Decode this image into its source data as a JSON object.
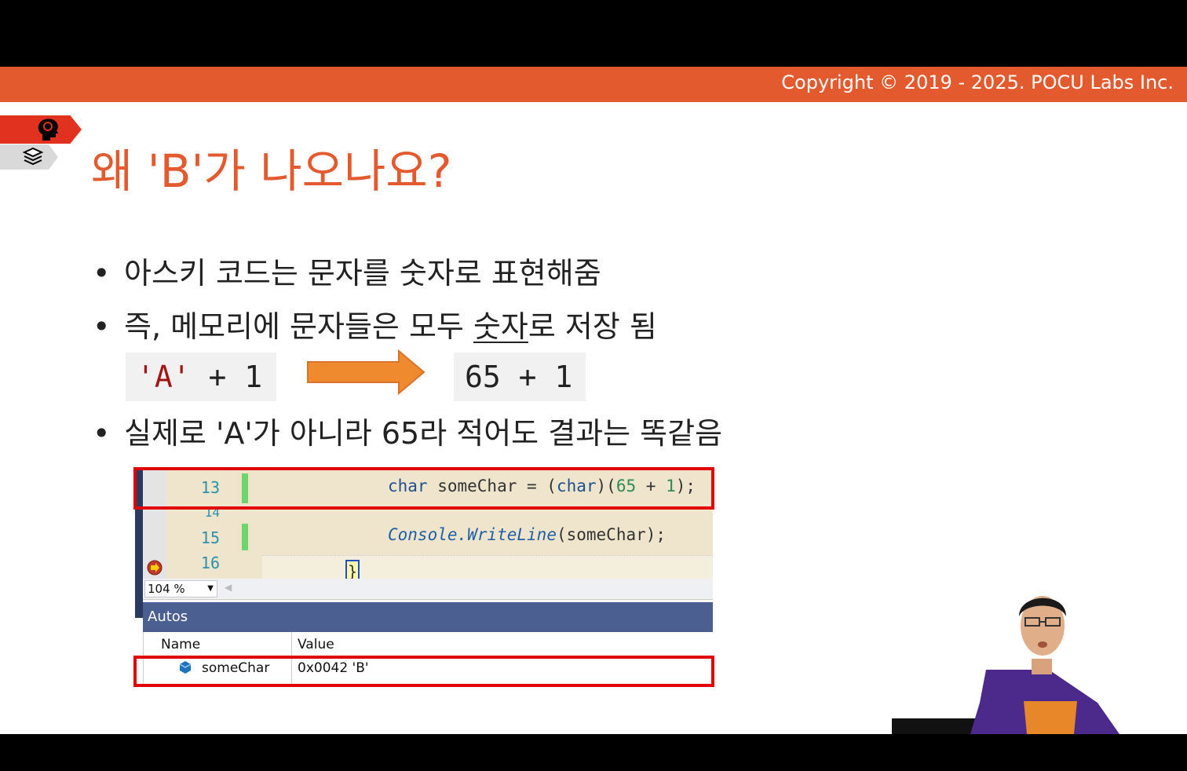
{
  "copyright": "Copyright © 2019 - 2025. POCU Labs Inc.",
  "side_tabs": {
    "top_icon": "brain-head-icon",
    "bottom_icon": "book-stack-icon"
  },
  "title": "왜 'B'가 나오나요?",
  "bullets": [
    {
      "symbol": "•",
      "text": "아스키 코드는 문자를 숫자로 표현해줌"
    },
    {
      "symbol": "•",
      "before": "즉, 메모리에 문자들은 모두 ",
      "emphasis": "숫자",
      "after": "로 저장 됨"
    },
    {
      "symbol": "•",
      "text": "실제로 'A'가 아니라 65라 적어도 결과는 똑같음"
    }
  ],
  "expression": {
    "char_literal": "'A'",
    "left_rest": " + 1",
    "right": "65 + 1",
    "arrow_icon": "right-arrow-icon"
  },
  "editor": {
    "line_numbers": [
      "13",
      "14",
      "15",
      "16"
    ],
    "line13": {
      "kw": "char",
      "mid": " someChar = (",
      "kw2": "char",
      "mid2": ")(",
      "num1": "65",
      "op": " + ",
      "num2": "1",
      "end": ");"
    },
    "line15": {
      "cls": "Console",
      "dot": ".",
      "method": "WriteLine",
      "args": "(someChar);"
    },
    "line16": "}",
    "zoom": "104 %"
  },
  "autos": {
    "title": "Autos",
    "col_name": "Name",
    "col_value": "Value",
    "row": {
      "name": "someChar",
      "value": "0x0042 'B'"
    }
  },
  "colors": {
    "accent": "#E35A2F",
    "highlight": "#E00000",
    "arrow": "#EF8A2F"
  }
}
